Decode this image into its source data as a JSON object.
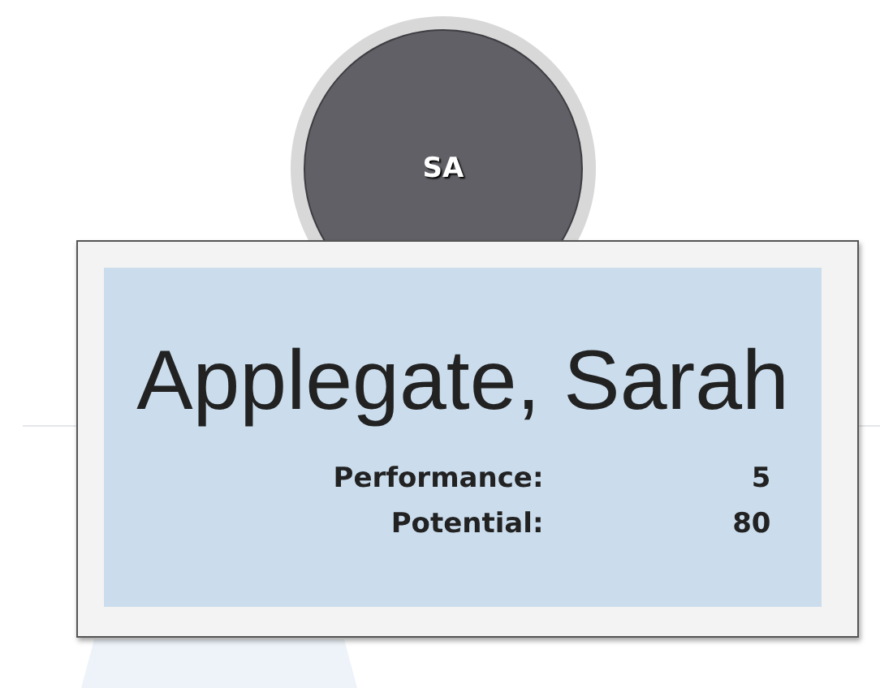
{
  "node": {
    "initials": "SA",
    "name": "Applegate, Sarah",
    "metrics": [
      {
        "label": "Performance:",
        "value": "5"
      },
      {
        "label": "Potential:",
        "value": "80"
      }
    ]
  }
}
